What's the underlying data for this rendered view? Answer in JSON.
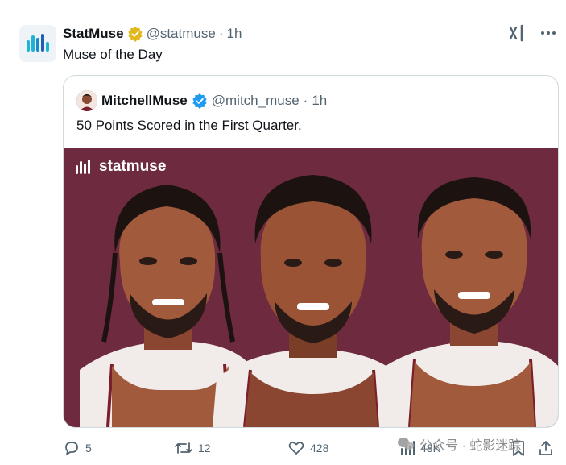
{
  "tweet": {
    "display_name": "StatMuse",
    "handle": "@statmuse",
    "dot": "·",
    "time": "1h",
    "text": "Muse of the Day"
  },
  "quote": {
    "display_name": "MitchellMuse",
    "handle": "@mitch_muse",
    "dot": "·",
    "time": "1h",
    "text": "50 Points Scored in the First Quarter.",
    "image_brand": "statmuse"
  },
  "actions": {
    "replies": "5",
    "retweets": "12",
    "likes": "428",
    "views": "48K"
  },
  "watermark": {
    "text": "公众号 · 蛇影迷踪"
  },
  "colors": {
    "media_bg": "#6e2a3f",
    "verified_gold": "#e2b719",
    "verified_blue": "#1d9bf0",
    "muted": "#536471"
  },
  "icons": [
    "statmuse-logo-icon",
    "gold-verified-icon",
    "grok-icon",
    "more-icon",
    "blue-verified-icon",
    "reply-icon",
    "retweet-icon",
    "like-icon",
    "views-icon",
    "bookmark-icon",
    "share-icon"
  ]
}
